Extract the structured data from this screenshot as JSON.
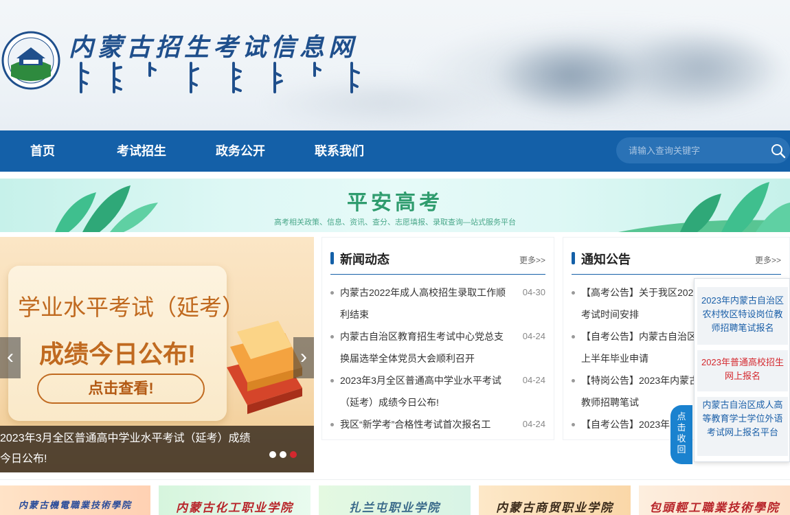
{
  "header": {
    "site_title": "内蒙古招生考试信息网"
  },
  "nav": {
    "items": [
      "首页",
      "考试招生",
      "政务公开",
      "联系我们"
    ],
    "search_placeholder": "请输入查询关键字"
  },
  "banner": {
    "title": "平安高考",
    "subtitle": "高考相关政策、信息、资讯、查分、志愿填报、录取查询—站式服务平台"
  },
  "slider": {
    "headline": "学业水平考试（延考）",
    "subheadline": "成绩今日公布!",
    "cta": "点击查看!",
    "caption": "2023年3月全区普通高中学业水平考试（延考）成绩今日公布!",
    "active_dot": 3,
    "dot_count": 3,
    "prev_arrow": "‹",
    "next_arrow": "›"
  },
  "news": {
    "title": "新闻动态",
    "more": "更多>>",
    "items": [
      {
        "text": "内蒙古2022年成人高校招生录取工作顺利结束",
        "date": "04-30"
      },
      {
        "text": "内蒙古自治区教育招生考试中心党总支换届选举全体党员大会顺利召开",
        "date": "04-24"
      },
      {
        "text": "2023年3月全区普通高中学业水平考试（延考）成绩今日公布!",
        "date": "04-24"
      },
      {
        "text": "我区“新学考”合格性考试首次报名工",
        "date": "04-24"
      }
    ]
  },
  "notices": {
    "title": "通知公告",
    "more": "更多>>",
    "items": [
      {
        "text": "【高考公告】关于我区2023年普通高校招生体育专业考试时间安排"
      },
      {
        "text": "【自考公告】内蒙古自治区高等教育自学考试2023年上半年毕业申请"
      },
      {
        "text": "【特岗公告】2023年内蒙古自治区农村牧区特设岗位教师招聘笔试"
      },
      {
        "text": "【自考公告】2023年"
      }
    ]
  },
  "float": {
    "tab_label": "点击收回",
    "items": [
      {
        "text": "2023年内蒙古自治区农村牧区特设岗位教师招聘笔试报名",
        "color": "#1a5fa8"
      },
      {
        "text": "2023年普通高校招生网上报名",
        "color": "#d4282e"
      },
      {
        "text": "内蒙古自治区成人高等教育学士学位外语考试网上报名平台",
        "color": "#1a5fa8"
      }
    ]
  },
  "colleges": [
    {
      "name": "内蒙古機電職業技術學院"
    },
    {
      "name": "内蒙古化工职业学院"
    },
    {
      "name": "扎兰屯职业学院"
    },
    {
      "name": "内蒙古商贸职业学院"
    },
    {
      "name": "包頭輕工職業技術學院"
    }
  ],
  "colors": {
    "nav_blue": "#1460a8",
    "accent_red": "#d4282e",
    "banner_green": "#2f9c6e"
  }
}
